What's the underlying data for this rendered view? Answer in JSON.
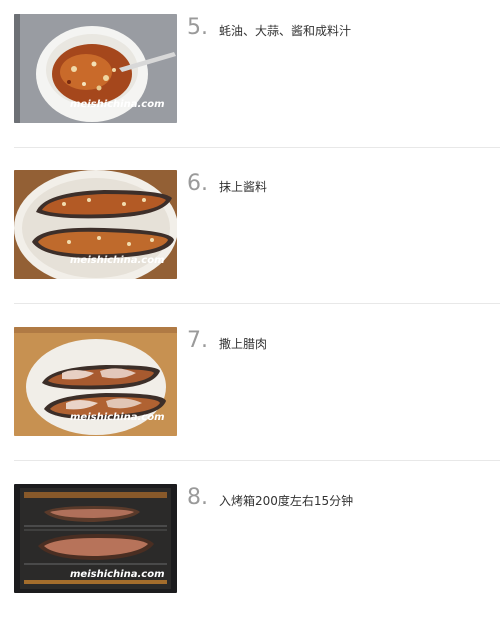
{
  "steps": [
    {
      "number": "5.",
      "description": "蚝油、大蒜、酱和成料汁",
      "watermark": "meishichina.com"
    },
    {
      "number": "6.",
      "description": "抹上酱料",
      "watermark": "meishichina.com"
    },
    {
      "number": "7.",
      "description": "撒上腊肉",
      "watermark": "meishichina.com"
    },
    {
      "number": "8.",
      "description": "入烤箱200度左右15分钟",
      "watermark": "meishichina.com"
    }
  ]
}
